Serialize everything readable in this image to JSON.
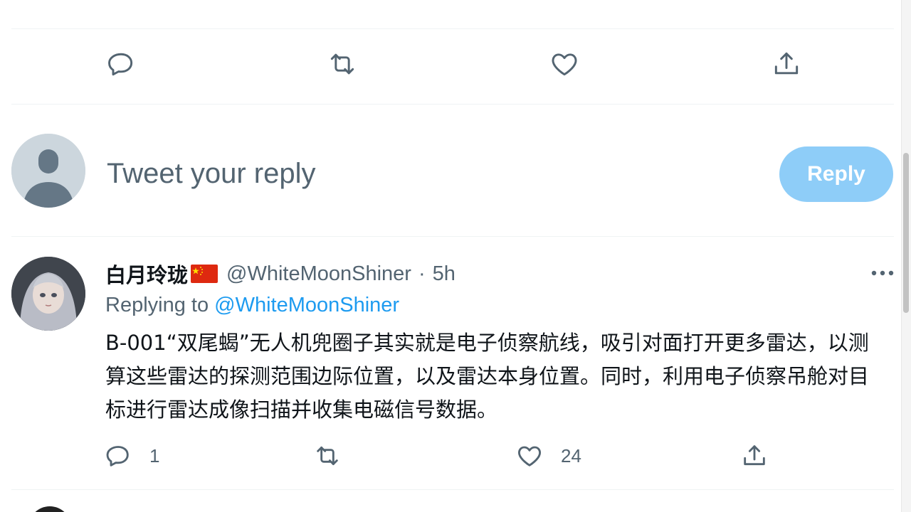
{
  "top_actions": {
    "reply_icon": "reply-bubble-icon",
    "retweet_icon": "retweet-icon",
    "like_icon": "heart-icon",
    "share_icon": "share-icon"
  },
  "composer": {
    "placeholder": "Tweet your reply",
    "reply_button_label": "Reply",
    "reply_button_color": "#8ecdf8"
  },
  "tweet": {
    "display_name": "白月玲珑",
    "flag_icon": "china-flag-icon",
    "handle": "@WhiteMoonShiner",
    "separator": "·",
    "time": "5h",
    "replying_prefix": "Replying to ",
    "replying_to": "@WhiteMoonShiner",
    "text": "B-001“双尾蝎”无人机兜圈子其实就是电子侦察航线，吸引对面打开更多雷达，以测算这些雷达的探测范围边际位置，以及雷达本身位置。同时，利用电子侦察吊舱对目标进行雷达成像扫描并收集电磁信号数据。",
    "reply_count": "1",
    "retweet_count": "",
    "like_count": "24"
  },
  "colors": {
    "accent": "#1d9bf0",
    "secondary_text": "#536471",
    "primary_text": "#0f1419"
  }
}
